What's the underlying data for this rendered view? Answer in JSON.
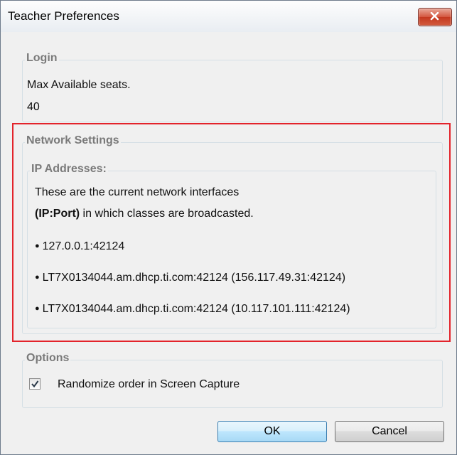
{
  "window": {
    "title": "Teacher Preferences"
  },
  "login": {
    "legend": "Login",
    "label": "Max Available seats.",
    "value": "40"
  },
  "network": {
    "legend": "Network Settings",
    "ip_legend": "IP Addresses:",
    "desc_line1": "These are the current network interfaces",
    "desc_bold": "(IP:Port)",
    "desc_rest": " in which classes are broadcasted.",
    "addresses": [
      "127.0.0.1:42124",
      "LT7X0134044.am.dhcp.ti.com:42124 (156.117.49.31:42124)",
      "LT7X0134044.am.dhcp.ti.com:42124 (10.117.101.111:42124)"
    ]
  },
  "options": {
    "legend": "Options",
    "randomize_label": "Randomize order in Screen Capture",
    "randomize_checked": true
  },
  "buttons": {
    "ok": "OK",
    "cancel": "Cancel"
  },
  "colors": {
    "highlight": "#e3232b",
    "close": "#c4381f"
  }
}
